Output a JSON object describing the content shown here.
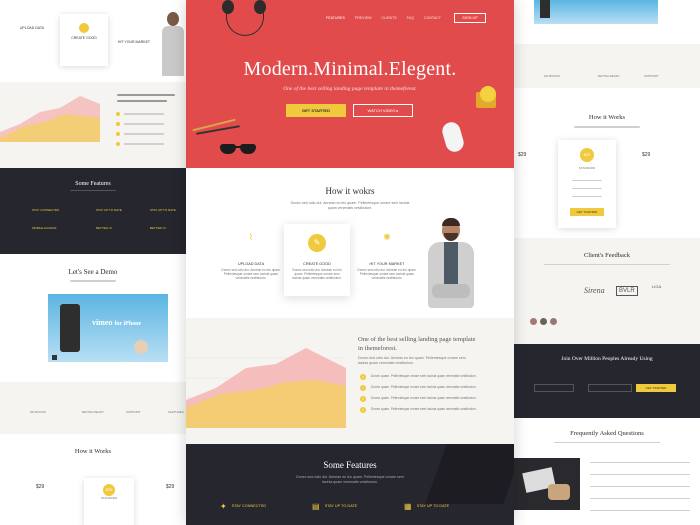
{
  "nav": {
    "items": [
      "FEATURES",
      "PREVIEW",
      "CLIENTS",
      "FAQ",
      "CONTACT"
    ],
    "signup": "SIGN UP"
  },
  "hero": {
    "title": "Modern.Minimal.Elegent.",
    "subtitle": "One of the best selling landing page template in themeforest.",
    "get_started": "GET STARTED",
    "watch_video": "WATCH VIDEO"
  },
  "how": {
    "title": "How it wokrs",
    "desc": "Donec sed odio dui. Aenean eu leo quam. Pellentesque ornare sem lacinia quam venenatis vestibulum.",
    "cards": [
      {
        "label": "UPLOAD DATA",
        "text": "Donec sed odio dui. Aenean eu leo quam. Pellentesque ornare sem lacinia quam venenatis vestibulum."
      },
      {
        "label": "CREATE GOOD",
        "text": "Donec sed odio dui. Aenean eu leo quam. Pellentesque ornare sem lacinia quam venenatis vestibulum."
      },
      {
        "label": "HIT YOUR MARKET",
        "text": "Donec sed odio dui. Aenean eu leo quam. Pellentesque ornare sem lacinia quam venenatis vestibulum."
      }
    ]
  },
  "selling": {
    "heading": "One of the best selling landing page template in themeforest.",
    "text": "Donec sed odio dui. Aenean eu leo quam. Pellentesque ornare sem lacinia quam venenatis vestibulum.",
    "checks": [
      "Donec quam. Pellentesque ornare sem lacinia quam venenatis vestibulum.",
      "Donec quam. Pellentesque ornare sem lacinia quam venenatis vestibulum.",
      "Donec quam. Pellentesque ornare sem lacinia quam venenatis vestibulum.",
      "Donec quam. Pellentesque ornare sem lacinia quam venenatis vestibulum."
    ]
  },
  "features": {
    "title": "Some Features",
    "desc": "Donec sed odio dui. Aenean eu leo quam. Pellentesque ornare sem lacinia quam venenatis vestibulum.",
    "items": [
      "STAY CONNECTED",
      "STAY UP TO DATE",
      "STAY UP TO DATE"
    ]
  },
  "left": {
    "cards": [
      "UPLOAD DATA",
      "CREATE GOOD",
      "HIT YOUR MARKET"
    ],
    "features_title": "Some Features",
    "feature_items": [
      "STAY CONNECTED",
      "STAY UP TO DATE",
      "STAY UP TO DATE",
      "MOBILE ACCESS",
      "BETTER UI",
      "BETTER UI"
    ],
    "demo_title": "Let's See a Demo",
    "video_text": "vimeo",
    "video_text2": "for iPhone",
    "icons": [
      "HD BOOKS",
      "RETINA READY",
      "SUPPORT",
      "FEATURES"
    ],
    "how_title": "How it Works",
    "prices": [
      "$29",
      "$29",
      "$29"
    ],
    "plan": "STANDARD"
  },
  "right": {
    "icons": [
      "HD BOOKS",
      "RETINA READY",
      "SUPPORT"
    ],
    "how_title": "How it Works",
    "prices": [
      "$29",
      "$29",
      "$29"
    ],
    "plan": "STANDARD",
    "get_started": "GET STARTED",
    "feedback_title": "Client's Feedback",
    "logos": [
      "Sirena",
      "BVLR",
      "LIGA"
    ],
    "cta_title": "Join Over Million Peoples Already Using",
    "cta_button": "GET STARTED",
    "faq_title": "Frequently Asked Questions"
  },
  "colors": {
    "red": "#e24b4b",
    "yellow": "#f0c93c",
    "dark": "#26262f"
  }
}
